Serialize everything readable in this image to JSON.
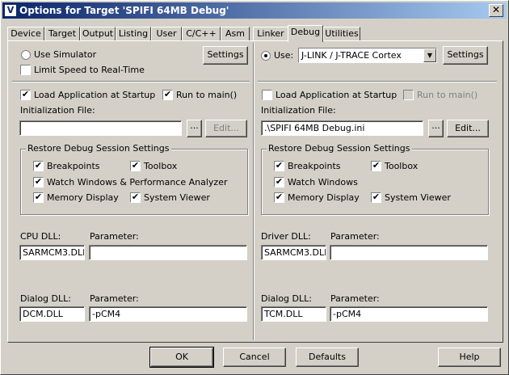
{
  "window": {
    "title": "Options for Target 'SPIFI 64MB Debug'",
    "close_label": "✕",
    "icon_glyph": "V"
  },
  "tabs": [
    {
      "label": "Device"
    },
    {
      "label": "Target"
    },
    {
      "label": "Output"
    },
    {
      "label": "Listing"
    },
    {
      "label": "User"
    },
    {
      "label": "C/C++"
    },
    {
      "label": "Asm"
    },
    {
      "label": "Linker"
    },
    {
      "label": "Debug"
    },
    {
      "label": "Utilities"
    }
  ],
  "active_tab": "Debug",
  "left": {
    "use_simulator_label": "Use Simulator",
    "use_simulator_selected": false,
    "limit_speed_label": "Limit Speed to Real-Time",
    "limit_speed_checked": false,
    "settings_label": "Settings",
    "load_app_label": "Load Application at Startup",
    "load_app_checked": true,
    "run_to_main_label": "Run to main()",
    "run_to_main_checked": true,
    "init_file_label": "Initialization File:",
    "init_file_value": "",
    "browse_label": "...",
    "edit_label": "Edit...",
    "restore_title": "Restore Debug Session Settings",
    "restore": {
      "breakpoints": {
        "label": "Breakpoints",
        "checked": true
      },
      "toolbox": {
        "label": "Toolbox",
        "checked": true
      },
      "watch": {
        "label": "Watch Windows & Performance Analyzer",
        "checked": true
      },
      "memory": {
        "label": "Memory Display",
        "checked": true
      },
      "sysview": {
        "label": "System Viewer",
        "checked": true
      }
    },
    "cpu_dll_label": "CPU DLL:",
    "cpu_dll_value": "SARMCM3.DLL",
    "cpu_param_label": "Parameter:",
    "cpu_param_value": "",
    "dialog_dll_label": "Dialog DLL:",
    "dialog_dll_value": "DCM.DLL",
    "dialog_param_label": "Parameter:",
    "dialog_param_value": "-pCM4"
  },
  "right": {
    "use_label": "Use:",
    "use_selected": true,
    "driver_value": "J-LINK / J-TRACE Cortex",
    "settings_label": "Settings",
    "load_app_label": "Load Application at Startup",
    "load_app_checked": false,
    "run_to_main_label": "Run to main()",
    "run_to_main_checked": false,
    "init_file_label": "Initialization File:",
    "init_file_value": ".\\SPIFI 64MB Debug.ini",
    "browse_label": "...",
    "edit_label": "Edit...",
    "restore_title": "Restore Debug Session Settings",
    "restore": {
      "breakpoints": {
        "label": "Breakpoints",
        "checked": true
      },
      "toolbox": {
        "label": "Toolbox",
        "checked": true
      },
      "watch": {
        "label": "Watch Windows",
        "checked": true
      },
      "memory": {
        "label": "Memory Display",
        "checked": true
      },
      "sysview": {
        "label": "System Viewer",
        "checked": true
      }
    },
    "driver_dll_label": "Driver DLL:",
    "driver_dll_value": "SARMCM3.DLL",
    "driver_param_label": "Parameter:",
    "driver_param_value": "",
    "dialog_dll_label": "Dialog DLL:",
    "dialog_dll_value": "TCM.DLL",
    "dialog_param_label": "Parameter:",
    "dialog_param_value": "-pCM4"
  },
  "footer": {
    "ok_label": "OK",
    "cancel_label": "Cancel",
    "defaults_label": "Defaults",
    "help_label": "Help"
  },
  "check_glyph": "✔",
  "combo_arrow_glyph": "▼"
}
